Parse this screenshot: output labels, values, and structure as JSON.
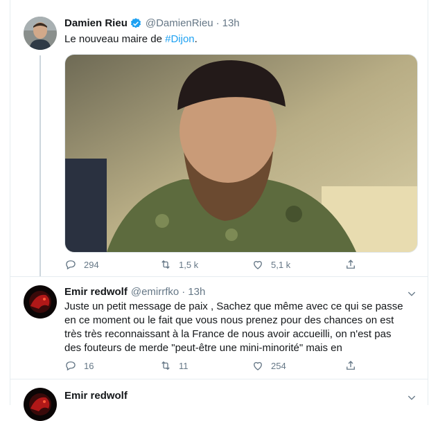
{
  "tweets": [
    {
      "display_name": "Damien Rieu",
      "handle": "@DamienRieu",
      "separator": "·",
      "time": "13h",
      "text_before": "Le nouveau maire de ",
      "hashtag": "#Dijon",
      "text_after": ".",
      "actions": {
        "reply": "294",
        "retweet": "1,5 k",
        "like": "5,1 k"
      }
    },
    {
      "display_name": "Emir redwolf",
      "handle": "@emirrfko",
      "separator": "·",
      "time": "13h",
      "text_lines": [
        "Juste un petit message de paix , Sachez  que même avec ce qui se passe",
        "en ce moment ou le fait que vous nous prenez pour des chances on est",
        "très très reconnaissant à la France de nous avoir accueilli, on n'est pas",
        "des fouteurs de merde \"peut-être une mini-minorité\" mais en"
      ],
      "actions": {
        "reply": "16",
        "retweet": "11",
        "like": "254"
      }
    },
    {
      "display_name": "Emir redwolf"
    }
  ],
  "colors": {
    "link": "#1da1f2",
    "muted": "#657786",
    "text": "#14171a"
  },
  "icons": [
    "verified-badge-icon",
    "chevron-down-icon",
    "reply-icon",
    "retweet-icon",
    "like-icon",
    "share-icon"
  ]
}
